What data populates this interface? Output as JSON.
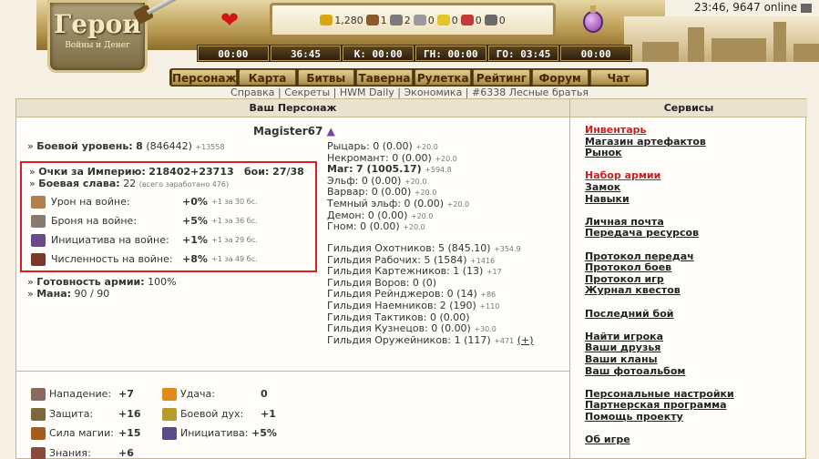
{
  "header": {
    "logo_title": "Герои",
    "logo_sub": "Войны и Денег",
    "clock": "23:46, 9647 online",
    "resources": [
      {
        "icon": "gold-icon",
        "value": "1,280",
        "color": "#d7a814"
      },
      {
        "icon": "wood-icon",
        "value": "1",
        "color": "#8a5a2a"
      },
      {
        "icon": "ore-icon",
        "value": "2",
        "color": "#7a7a7a"
      },
      {
        "icon": "mercury-icon",
        "value": "0",
        "color": "#9a9aa0"
      },
      {
        "icon": "sulfur-icon",
        "value": "0",
        "color": "#e3c52a"
      },
      {
        "icon": "crystal-icon",
        "value": "0",
        "color": "#c43a3a"
      },
      {
        "icon": "gem-icon",
        "value": "0",
        "color": "#6a6a6a"
      }
    ],
    "timers": [
      "00:00",
      "36:45",
      "К: 00:00",
      "ГН: 00:00",
      "ГО: 03:45",
      "00:00"
    ],
    "nav": [
      "Персонаж",
      "Карта",
      "Битвы",
      "Таверна",
      "Рулетка",
      "Рейтинг",
      "Форум",
      "Чат"
    ]
  },
  "toplinks": [
    "Справка",
    "Секреты",
    "HWM Daily",
    "Экономика",
    "#6338 Лесные братья"
  ],
  "character": {
    "panel_title": "Ваш Персонаж",
    "nickname": "Magister67",
    "level_label": "Боевой уровень:",
    "level": "8",
    "level_exp": "(846442)",
    "level_delta": "+13558",
    "empire_label": "Очки за Империю:",
    "empire_value": "218402+23713",
    "battles": "бои: 27/38",
    "glory_label": "Боевая слава:",
    "glory_value": "22",
    "glory_note": "(всего заработано 476)",
    "war_bonuses": [
      {
        "icon": "damage-icon",
        "label": "Урон на войне:",
        "value": "+0%",
        "note": "+1 за 30 бс."
      },
      {
        "icon": "armor-icon",
        "label": "Броня на войне:",
        "value": "+5%",
        "note": "+1 за 36 бс."
      },
      {
        "icon": "initiative-icon",
        "label": "Инициатива на войне:",
        "value": "+1%",
        "note": "+1 за 29 бс."
      },
      {
        "icon": "army-size-icon",
        "label": "Численность на войне:",
        "value": "+8%",
        "note": "+1 за 49 бс."
      }
    ],
    "readiness_label": "Готовность армии:",
    "readiness_value": "100%",
    "mana_label": "Мана:",
    "mana_value": "90 / 90",
    "factions": [
      {
        "name": "Рыцарь:",
        "value": "0 (0.00)",
        "note": "+20.0"
      },
      {
        "name": "Некромант:",
        "value": "0 (0.00)",
        "note": "+20.0"
      },
      {
        "name": "Маг:",
        "value": "7 (1005.17)",
        "note": "+594.8",
        "bold": true
      },
      {
        "name": "Эльф:",
        "value": "0 (0.00)",
        "note": "+20.0"
      },
      {
        "name": "Варвар:",
        "value": "0 (0.00)",
        "note": "+20.0"
      },
      {
        "name": "Темный эльф:",
        "value": "0 (0.00)",
        "note": "+20.0"
      },
      {
        "name": "Демон:",
        "value": "0 (0.00)",
        "note": "+20.0"
      },
      {
        "name": "Гном:",
        "value": "0 (0.00)",
        "note": "+20.0"
      }
    ],
    "guilds": [
      {
        "name": "Гильдия Охотников:",
        "value": "5 (845.10)",
        "note": "+354.9"
      },
      {
        "name": "Гильдия Рабочих:",
        "value": "5 (1584)",
        "note": "+1416"
      },
      {
        "name": "Гильдия Картежников:",
        "value": "1 (13)",
        "note": "+17"
      },
      {
        "name": "Гильдия Воров:",
        "value": "0 (0)",
        "note": ""
      },
      {
        "name": "Гильдия Рейнджеров:",
        "value": "0 (14)",
        "note": "+86"
      },
      {
        "name": "Гильдия Наемников:",
        "value": "2 (190)",
        "note": "+110"
      },
      {
        "name": "Гильдия Тактиков:",
        "value": "0 (0.00)",
        "note": ""
      },
      {
        "name": "Гильдия Кузнецов:",
        "value": "0 (0.00)",
        "note": "+30.0"
      },
      {
        "name": "Гильдия Оружейников:",
        "value": "1 (117)",
        "note": "+471"
      }
    ],
    "guild_plus": "(+)",
    "stats_left": [
      {
        "icon": "attack-icon",
        "label": "Нападение:",
        "value": "+7"
      },
      {
        "icon": "defense-icon",
        "label": "Защита:",
        "value": "+16"
      },
      {
        "icon": "spellpower-icon",
        "label": "Сила магии:",
        "value": "+15"
      },
      {
        "icon": "knowledge-icon",
        "label": "Знания:",
        "value": "+6"
      }
    ],
    "stats_right": [
      {
        "icon": "luck-icon",
        "label": "Удача:",
        "value": "0"
      },
      {
        "icon": "morale-icon",
        "label": "Боевой дух:",
        "value": "+1"
      },
      {
        "icon": "initiative-stat-icon",
        "label": "Инициатива:",
        "value": "+5%"
      }
    ]
  },
  "services": {
    "title": "Сервисы",
    "groups": [
      [
        {
          "label": "Инвентарь",
          "red": true
        },
        {
          "label": "Магазин артефактов"
        },
        {
          "label": "Рынок"
        }
      ],
      [
        {
          "label": "Набор армии",
          "red": true
        },
        {
          "label": "Замок"
        },
        {
          "label": "Навыки"
        }
      ],
      [
        {
          "label": "Личная почта"
        },
        {
          "label": "Передача ресурсов"
        }
      ],
      [
        {
          "label": "Протокол передач"
        },
        {
          "label": "Протокол боев"
        },
        {
          "label": "Протокол игр"
        },
        {
          "label": "Журнал квестов"
        }
      ],
      [
        {
          "label": "Последний бой"
        }
      ],
      [
        {
          "label": "Найти игрока"
        },
        {
          "label": "Ваши друзья"
        },
        {
          "label": "Ваши кланы"
        },
        {
          "label": "Ваш фотоальбом"
        }
      ],
      [
        {
          "label": "Персональные настройки"
        },
        {
          "label": "Партнерская программа"
        },
        {
          "label": "Помощь проекту"
        }
      ],
      [
        {
          "label": "Об игре"
        }
      ]
    ]
  }
}
